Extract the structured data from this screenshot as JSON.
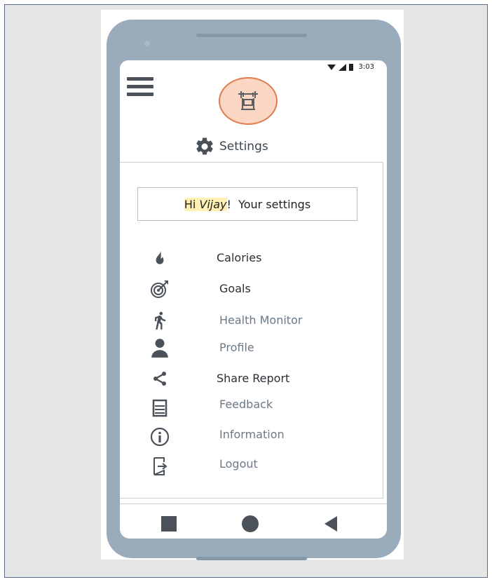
{
  "status_bar": {
    "time": "3:03"
  },
  "header": {
    "title": "Settings"
  },
  "greeting": {
    "prefix": "Hi ",
    "name": "Vijay",
    "suffix": "!  Your settings"
  },
  "menu": [
    {
      "label": "Calories",
      "icon": "flame-icon"
    },
    {
      "label": "Goals",
      "icon": "target-icon"
    },
    {
      "label": "Health Monitor",
      "icon": "runner-icon"
    },
    {
      "label": "Profile",
      "icon": "person-icon"
    },
    {
      "label": "Share Report",
      "icon": "share-icon"
    },
    {
      "label": "Feedback",
      "icon": "feedback-icon"
    },
    {
      "label": "Information",
      "icon": "info-icon"
    },
    {
      "label": "Logout",
      "icon": "logout-icon"
    }
  ],
  "colors": {
    "phone_body": "#9aabbb",
    "logo_fill": "#fbd7c3",
    "logo_border": "#e07a4f",
    "highlight": "#fff0b3",
    "icon": "#4a5158"
  }
}
